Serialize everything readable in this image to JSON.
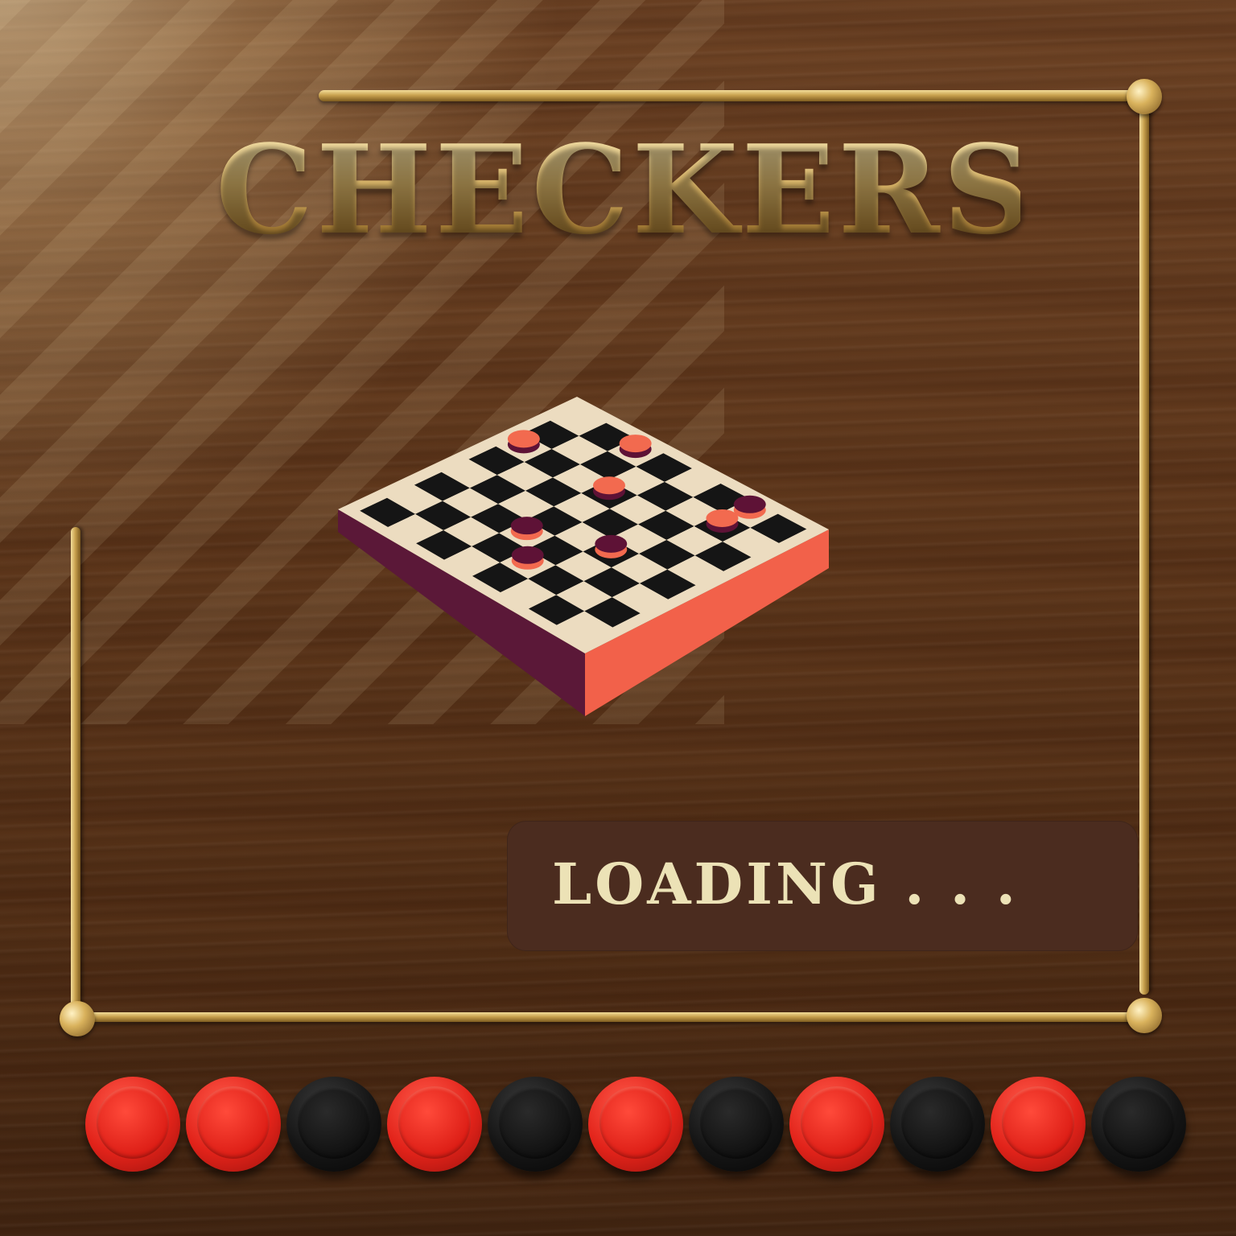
{
  "title": "CHECKERS",
  "loading": {
    "label": "LOADING . . ."
  },
  "colors": {
    "wood": "#5a3419",
    "gold": "#d6b266",
    "panel": "#4b2c1f",
    "loading_text": "#ece2b6",
    "board_light": "#ecdcc0",
    "board_dark": "#151515",
    "board_side_left": "#5b1838",
    "board_side_right": "#f2614a",
    "piece_orange": "#f26a4f",
    "piece_plum": "#5e1236",
    "chip_red": "#e2231a",
    "chip_black": "#111111"
  },
  "board_pieces": [
    {
      "row": 0,
      "col": 2,
      "color": "orange"
    },
    {
      "row": 2,
      "col": 0,
      "color": "orange"
    },
    {
      "row": 2,
      "col": 3,
      "color": "orange"
    },
    {
      "row": 1,
      "col": 6,
      "color": "orange"
    },
    {
      "row": 0,
      "col": 6,
      "color": "plum"
    },
    {
      "row": 4,
      "col": 5,
      "color": "plum"
    },
    {
      "row": 5,
      "col": 3,
      "color": "plum"
    },
    {
      "row": 6,
      "col": 4,
      "color": "plum"
    }
  ],
  "chip_row": [
    "red",
    "red",
    "black",
    "red",
    "black",
    "red",
    "black",
    "red",
    "black",
    "red",
    "black"
  ]
}
